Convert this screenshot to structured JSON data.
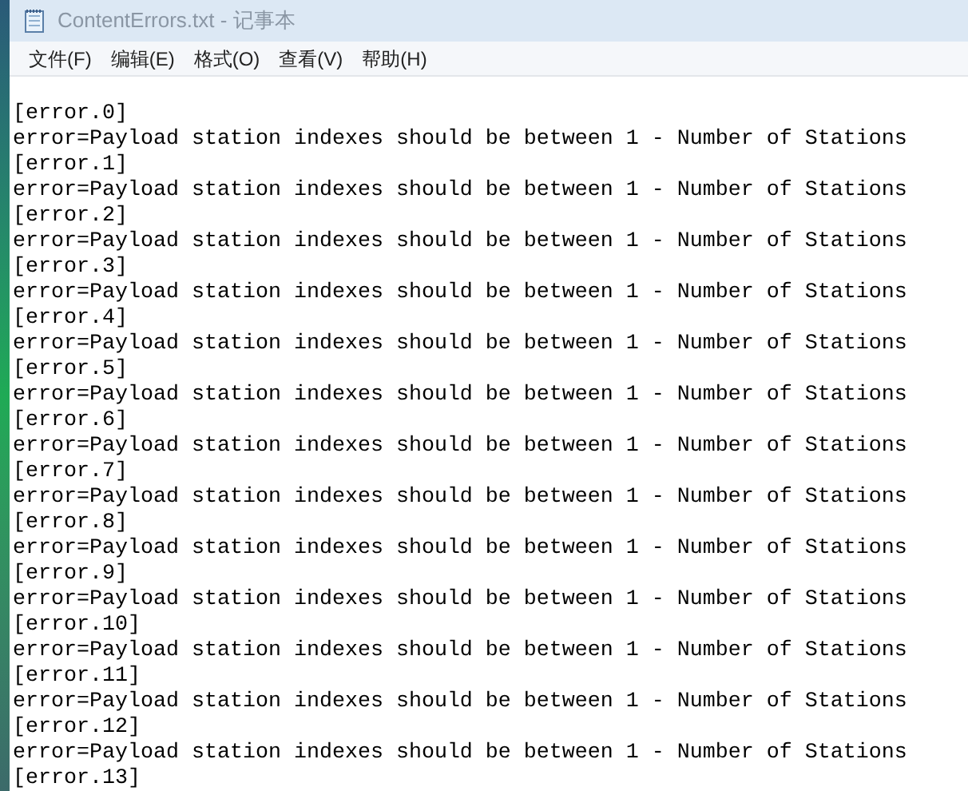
{
  "window": {
    "title": "ContentErrors.txt - 记事本"
  },
  "menu": [
    "文件(F)",
    "编辑(E)",
    "格式(O)",
    "查看(V)",
    "帮助(H)"
  ],
  "lines": [
    "[error.0]",
    "error=Payload station indexes should be between 1 - Number of Stations",
    "[error.1]",
    "error=Payload station indexes should be between 1 - Number of Stations",
    "[error.2]",
    "error=Payload station indexes should be between 1 - Number of Stations",
    "[error.3]",
    "error=Payload station indexes should be between 1 - Number of Stations",
    "[error.4]",
    "error=Payload station indexes should be between 1 - Number of Stations",
    "[error.5]",
    "error=Payload station indexes should be between 1 - Number of Stations",
    "[error.6]",
    "error=Payload station indexes should be between 1 - Number of Stations",
    "[error.7]",
    "error=Payload station indexes should be between 1 - Number of Stations",
    "[error.8]",
    "error=Payload station indexes should be between 1 - Number of Stations",
    "[error.9]",
    "error=Payload station indexes should be between 1 - Number of Stations",
    "[error.10]",
    "error=Payload station indexes should be between 1 - Number of Stations",
    "[error.11]",
    "error=Payload station indexes should be between 1 - Number of Stations",
    "[error.12]",
    "error=Payload station indexes should be between 1 - Number of Stations",
    "[error.13]"
  ]
}
